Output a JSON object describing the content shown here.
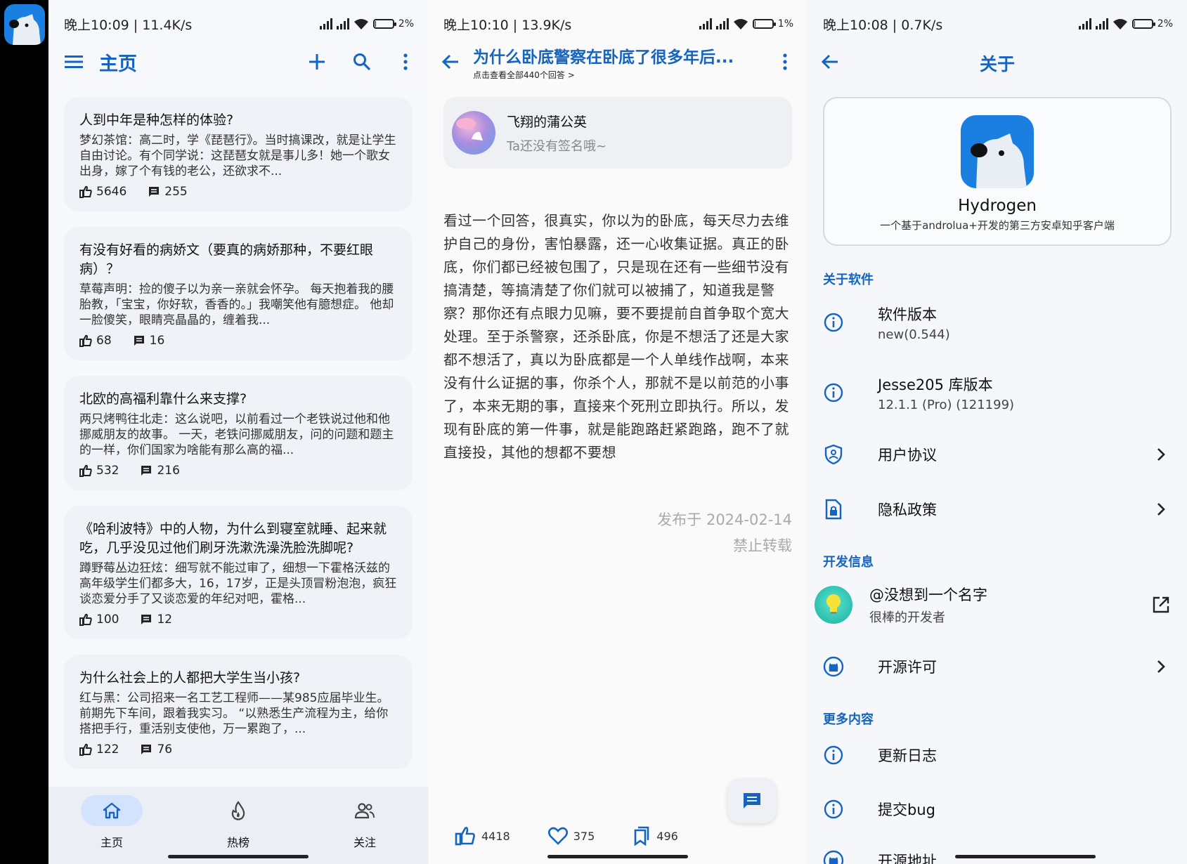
{
  "panel1": {
    "status": {
      "time": "晚上10:09 | 11.4K/s",
      "battery": "2%",
      "battery_level": 0.02
    },
    "title": "主页",
    "cards": [
      {
        "question": "人到中年是种怎样的体验?",
        "excerpt": "梦幻茶馆：高二时，学《琵琶行》。当时搞课改，就是让学生自由讨论。有个同学说：这琵琶女就是事儿多！她一个歌女出身，嫁了个有钱的老公，还欲求不...",
        "likes": "5646",
        "comments": "255"
      },
      {
        "question": "有没有好看的病娇文（要真的病娇那种，不要红眼病）？",
        "excerpt": "草莓声明：捡的傻子以为亲一亲就会怀孕。 每天抱着我的腰胎教，「宝宝，你好软，香香的。」我嘲笑他有臆想症。 他却一脸傻笑，眼睛亮晶晶的，缠着我...",
        "likes": "68",
        "comments": "16"
      },
      {
        "question": "北欧的高福利靠什么来支撑?",
        "excerpt": "两只烤鸭往北走：这么说吧，以前看过一个老铁说过他和他挪威朋友的故事。 一天，老铁问挪威朋友，问的问题和题主的一样，你们国家为啥能有那么高的福...",
        "likes": "532",
        "comments": "216"
      },
      {
        "question": "《哈利波特》中的人物，为什么到寝室就睡、起来就吃，几乎没见过他们刷牙洗漱洗澡洗脸洗脚呢?",
        "excerpt": "蹲野莓丛边狂炫：细写就不能过审了，细想一下霍格沃兹的高年级学生们都多大，16，17岁，正是头顶冒粉泡泡，疯狂谈恋爱分手了又谈恋爱的年纪对吧，霍格...",
        "likes": "100",
        "comments": "12"
      },
      {
        "question": "为什么社会上的人都把大学生当小孩?",
        "excerpt": "红与黑：公司招来一名工艺工程师——某985应届毕业生。 前期先下车间，跟着我实习。 “以熟悉生产流程为主，给你搭把手行，重活别支使他，万一累跑了，...",
        "likes": "122",
        "comments": "76"
      }
    ],
    "nav": [
      {
        "label": "主页",
        "icon": "home-icon"
      },
      {
        "label": "热榜",
        "icon": "fire-icon"
      },
      {
        "label": "关注",
        "icon": "people-icon"
      }
    ]
  },
  "panel2": {
    "status": {
      "time": "晚上10:10 | 13.9K/s",
      "battery": "1%",
      "battery_level": 0.01
    },
    "title": "为什么卧底警察在卧底了很多年后...",
    "subtitle": "点击查看全部440个回答 >",
    "author": {
      "name": "飞翔的蒲公英",
      "signature": "Ta还没有签名哦~"
    },
    "answer": "看过一个回答，很真实，你以为的卧底，每天尽力去维护自己的身份，害怕暴露，还一心收集证据。真正的卧底，你们都已经被包围了，只是现在还有一些细节没有搞清楚，等搞清楚了你们就可以被捕了，知道我是警察？那你还有点眼力见嘛，要不要提前自首争取个宽大处理。至于杀警察，还杀卧底，你是不想活了还是大家都不想活了，真以为卧底都是一个人单线作战啊，本来没有什么证据的事，你杀个人，那就不是以前范的小事了，本来无期的事，直接来个死刑立即执行。所以，发现有卧底的第一件事，就是能跑路赶紧跑路，跑不了就直接投，其他的想都不要想",
    "published": "发布于 2024-02-14",
    "copyright": "禁止转载",
    "likes": "4418",
    "favorites": "375",
    "collections": "496"
  },
  "panel3": {
    "status": {
      "time": "晚上10:08 | 0.7K/s",
      "battery": "2%",
      "battery_level": 0.02
    },
    "title": "关于",
    "app_name": "Hydrogen",
    "app_desc": "一个基于androlua+开发的第三方安卓知乎客户端",
    "sections": {
      "software": "关于软件",
      "dev": "开发信息",
      "more": "更多内容"
    },
    "rows": {
      "version_title": "软件版本",
      "version_value": "new(0.544)",
      "lib_title": "Jesse205 库版本",
      "lib_value": "12.1.1 (Pro) (121199)",
      "agreement": "用户协议",
      "privacy": "隐私政策",
      "dev_name": "@没想到一个名字",
      "dev_desc": "很棒的开发者",
      "license": "开源许可",
      "changelog": "更新日志",
      "bug": "提交bug",
      "repo": "开源地址"
    }
  }
}
